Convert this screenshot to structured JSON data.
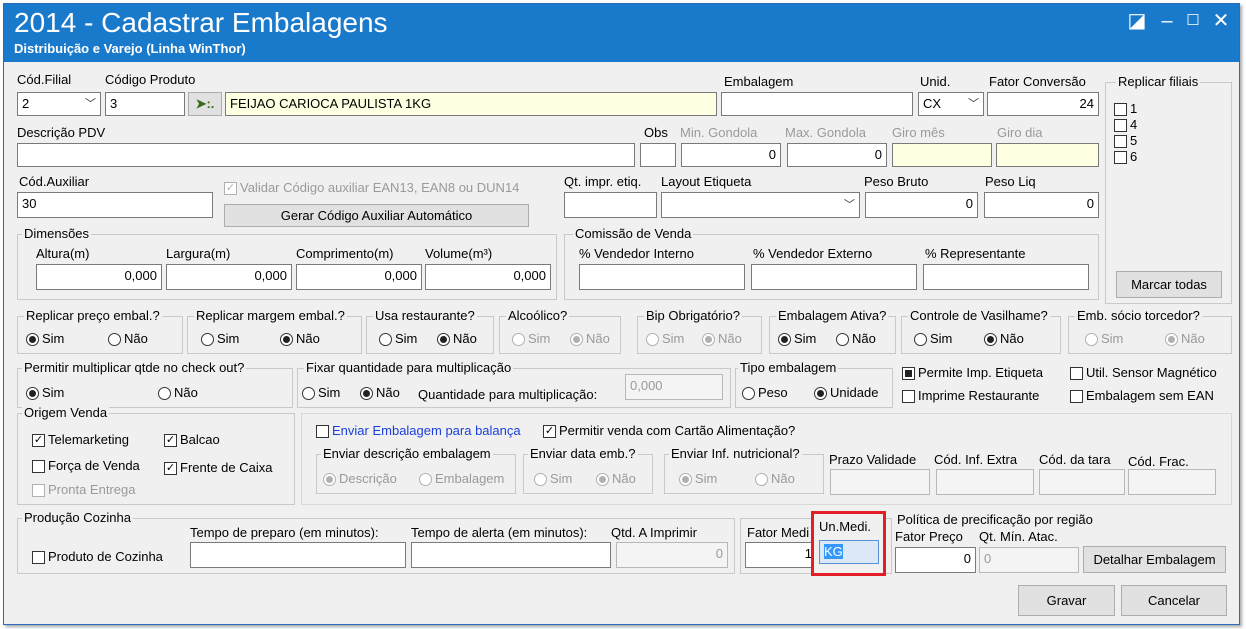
{
  "window": {
    "title": "2014 - Cadastrar Embalagens",
    "subtitle": "Distribuição e Varejo (Linha WinThor)",
    "buttons": {
      "restore": "◪",
      "minimize": "–",
      "maximize": "☐",
      "close": "✕"
    }
  },
  "row1": {
    "filial_label": "Cód.Filial",
    "filial_value": "2",
    "produto_label": "Código Produto",
    "produto_value": "3",
    "produto_desc": "FEIJAO CARIOCA PAULISTA 1KG",
    "embalagem_label": "Embalagem",
    "embalagem_value": "",
    "unid_label": "Unid.",
    "unid_value": "CX",
    "fator_label": "Fator Conversão",
    "fator_value": "24"
  },
  "replicar_filiais": {
    "title": "Replicar filiais",
    "items": [
      "1",
      "4",
      "5",
      "6"
    ],
    "button": "Marcar todas"
  },
  "row2": {
    "descricao_label": "Descrição PDV",
    "descricao_value": "",
    "obs_label": "Obs",
    "obs_value": "",
    "min_gondola_label": "Min. Gondola",
    "min_gondola_value": "0",
    "max_gondola_label": "Max. Gondola",
    "max_gondola_value": "0",
    "giro_mes_label": "Giro mês",
    "giro_dia_label": "Giro dia"
  },
  "row3": {
    "auxiliar_label": "Cód.Auxiliar",
    "auxiliar_value": "30",
    "validar_label": "Validar Código auxiliar EAN13, EAN8 ou DUN14",
    "gerar_button": "Gerar Código Auxiliar Automático",
    "qt_impr_label": "Qt. impr. etiq.",
    "layout_label": "Layout Etiqueta",
    "peso_bruto_label": "Peso Bruto",
    "peso_bruto_value": "0",
    "peso_liq_label": "Peso Liq",
    "peso_liq_value": "0"
  },
  "dimensoes": {
    "title": "Dimensões",
    "altura_label": "Altura(m)",
    "altura_value": "0,000",
    "largura_label": "Largura(m)",
    "largura_value": "0,000",
    "comprimento_label": "Comprimento(m)",
    "comprimento_value": "0,000",
    "volume_label": "Volume(m³)",
    "volume_value": "0,000"
  },
  "comissao": {
    "title": "Comissão de Venda",
    "interno_label": "% Vendedor Interno",
    "externo_label": "% Vendedor Externo",
    "representante_label": "% Representante"
  },
  "radios_row": {
    "sim": "Sim",
    "nao": "Não",
    "replicar_preco": "Replicar preço embal.?",
    "replicar_margem": "Replicar margem embal.?",
    "usa_restaurante": "Usa restaurante?",
    "alcoolico": "Alcoólico?",
    "bip": "Bip Obrigatório?",
    "ativa": "Embalagem Ativa?",
    "vasilhame": "Controle de Vasilhame?",
    "socio": "Emb. sócio torcedor?"
  },
  "row_mult": {
    "permitir_title": "Permitir multiplicar qtde no check out?",
    "fixar_title": "Fixar quantidade para multiplicação",
    "qtd_mult_label": "Quantidade para multiplicação:",
    "qtd_mult_value": "0,000",
    "tipo_title": "Tipo embalagem",
    "peso": "Peso",
    "unidade": "Unidade",
    "permite_imp": "Permite Imp. Etiqueta",
    "imprime_rest": "Imprime Restaurante",
    "sensor": "Util. Sensor Magnético",
    "sem_ean": "Embalagem sem EAN"
  },
  "origem": {
    "title": "Origem Venda",
    "telemarketing": "Telemarketing",
    "balcao": "Balcao",
    "forca": "Força de Venda",
    "frente": "Frente de Caixa",
    "pronta": "Pronta Entrega"
  },
  "balanca": {
    "enviar_emb": "Enviar Embalagem para balança",
    "cartao": "Permitir venda com Cartão Alimentação?",
    "desc_title": "Enviar descrição embalagem",
    "descricao": "Descrição",
    "embalagem": "Embalagem",
    "data_title": "Enviar data emb.?",
    "nutri_title": "Enviar Inf. nutricional?",
    "prazo_label": "Prazo Validade",
    "inf_extra_label": "Cód. Inf. Extra",
    "tara_label": "Cód. da tara",
    "frac_label": "Cód. Frac."
  },
  "producao": {
    "title": "Produção Cozinha",
    "produto_cozinha": "Produto de Cozinha",
    "preparo_label": "Tempo de preparo (em minutos):",
    "alerta_label": "Tempo de alerta (em minutos):",
    "qtd_label": "Qtd. A Imprimir",
    "qtd_value": "0"
  },
  "fator_medida": {
    "label": "Fator Medi",
    "value": "1"
  },
  "un_medida": {
    "label": "Un.Medi.",
    "value": "KG",
    "highlight_color": "#e31e24"
  },
  "politica": {
    "title": "Política de precificação por região",
    "fator_preco_label": "Fator Preço",
    "fator_preco_value": "0",
    "qt_min_label": "Qt. Mín. Atac.",
    "qt_min_value": "0",
    "detalhar_button": "Detalhar Embalagem"
  },
  "actions": {
    "gravar": "Gravar",
    "cancelar": "Cancelar"
  }
}
